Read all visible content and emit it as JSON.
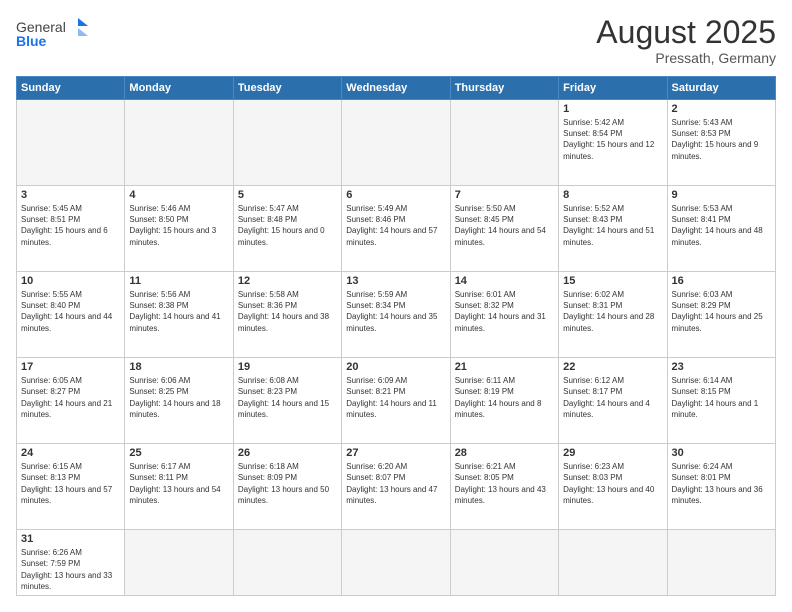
{
  "header": {
    "logo_general": "General",
    "logo_blue": "Blue",
    "month_title": "August 2025",
    "subtitle": "Pressath, Germany"
  },
  "weekdays": [
    "Sunday",
    "Monday",
    "Tuesday",
    "Wednesday",
    "Thursday",
    "Friday",
    "Saturday"
  ],
  "weeks": [
    [
      {
        "day": "",
        "info": "",
        "empty": true
      },
      {
        "day": "",
        "info": "",
        "empty": true
      },
      {
        "day": "",
        "info": "",
        "empty": true
      },
      {
        "day": "",
        "info": "",
        "empty": true
      },
      {
        "day": "",
        "info": "",
        "empty": true
      },
      {
        "day": "1",
        "info": "Sunrise: 5:42 AM\nSunset: 8:54 PM\nDaylight: 15 hours and 12 minutes."
      },
      {
        "day": "2",
        "info": "Sunrise: 5:43 AM\nSunset: 8:53 PM\nDaylight: 15 hours and 9 minutes."
      }
    ],
    [
      {
        "day": "3",
        "info": "Sunrise: 5:45 AM\nSunset: 8:51 PM\nDaylight: 15 hours and 6 minutes."
      },
      {
        "day": "4",
        "info": "Sunrise: 5:46 AM\nSunset: 8:50 PM\nDaylight: 15 hours and 3 minutes."
      },
      {
        "day": "5",
        "info": "Sunrise: 5:47 AM\nSunset: 8:48 PM\nDaylight: 15 hours and 0 minutes."
      },
      {
        "day": "6",
        "info": "Sunrise: 5:49 AM\nSunset: 8:46 PM\nDaylight: 14 hours and 57 minutes."
      },
      {
        "day": "7",
        "info": "Sunrise: 5:50 AM\nSunset: 8:45 PM\nDaylight: 14 hours and 54 minutes."
      },
      {
        "day": "8",
        "info": "Sunrise: 5:52 AM\nSunset: 8:43 PM\nDaylight: 14 hours and 51 minutes."
      },
      {
        "day": "9",
        "info": "Sunrise: 5:53 AM\nSunset: 8:41 PM\nDaylight: 14 hours and 48 minutes."
      }
    ],
    [
      {
        "day": "10",
        "info": "Sunrise: 5:55 AM\nSunset: 8:40 PM\nDaylight: 14 hours and 44 minutes."
      },
      {
        "day": "11",
        "info": "Sunrise: 5:56 AM\nSunset: 8:38 PM\nDaylight: 14 hours and 41 minutes."
      },
      {
        "day": "12",
        "info": "Sunrise: 5:58 AM\nSunset: 8:36 PM\nDaylight: 14 hours and 38 minutes."
      },
      {
        "day": "13",
        "info": "Sunrise: 5:59 AM\nSunset: 8:34 PM\nDaylight: 14 hours and 35 minutes."
      },
      {
        "day": "14",
        "info": "Sunrise: 6:01 AM\nSunset: 8:32 PM\nDaylight: 14 hours and 31 minutes."
      },
      {
        "day": "15",
        "info": "Sunrise: 6:02 AM\nSunset: 8:31 PM\nDaylight: 14 hours and 28 minutes."
      },
      {
        "day": "16",
        "info": "Sunrise: 6:03 AM\nSunset: 8:29 PM\nDaylight: 14 hours and 25 minutes."
      }
    ],
    [
      {
        "day": "17",
        "info": "Sunrise: 6:05 AM\nSunset: 8:27 PM\nDaylight: 14 hours and 21 minutes."
      },
      {
        "day": "18",
        "info": "Sunrise: 6:06 AM\nSunset: 8:25 PM\nDaylight: 14 hours and 18 minutes."
      },
      {
        "day": "19",
        "info": "Sunrise: 6:08 AM\nSunset: 8:23 PM\nDaylight: 14 hours and 15 minutes."
      },
      {
        "day": "20",
        "info": "Sunrise: 6:09 AM\nSunset: 8:21 PM\nDaylight: 14 hours and 11 minutes."
      },
      {
        "day": "21",
        "info": "Sunrise: 6:11 AM\nSunset: 8:19 PM\nDaylight: 14 hours and 8 minutes."
      },
      {
        "day": "22",
        "info": "Sunrise: 6:12 AM\nSunset: 8:17 PM\nDaylight: 14 hours and 4 minutes."
      },
      {
        "day": "23",
        "info": "Sunrise: 6:14 AM\nSunset: 8:15 PM\nDaylight: 14 hours and 1 minute."
      }
    ],
    [
      {
        "day": "24",
        "info": "Sunrise: 6:15 AM\nSunset: 8:13 PM\nDaylight: 13 hours and 57 minutes."
      },
      {
        "day": "25",
        "info": "Sunrise: 6:17 AM\nSunset: 8:11 PM\nDaylight: 13 hours and 54 minutes."
      },
      {
        "day": "26",
        "info": "Sunrise: 6:18 AM\nSunset: 8:09 PM\nDaylight: 13 hours and 50 minutes."
      },
      {
        "day": "27",
        "info": "Sunrise: 6:20 AM\nSunset: 8:07 PM\nDaylight: 13 hours and 47 minutes."
      },
      {
        "day": "28",
        "info": "Sunrise: 6:21 AM\nSunset: 8:05 PM\nDaylight: 13 hours and 43 minutes."
      },
      {
        "day": "29",
        "info": "Sunrise: 6:23 AM\nSunset: 8:03 PM\nDaylight: 13 hours and 40 minutes."
      },
      {
        "day": "30",
        "info": "Sunrise: 6:24 AM\nSunset: 8:01 PM\nDaylight: 13 hours and 36 minutes."
      }
    ],
    [
      {
        "day": "31",
        "info": "Sunrise: 6:26 AM\nSunset: 7:59 PM\nDaylight: 13 hours and 33 minutes."
      },
      {
        "day": "",
        "info": "",
        "empty": true
      },
      {
        "day": "",
        "info": "",
        "empty": true
      },
      {
        "day": "",
        "info": "",
        "empty": true
      },
      {
        "day": "",
        "info": "",
        "empty": true
      },
      {
        "day": "",
        "info": "",
        "empty": true
      },
      {
        "day": "",
        "info": "",
        "empty": true
      }
    ]
  ]
}
